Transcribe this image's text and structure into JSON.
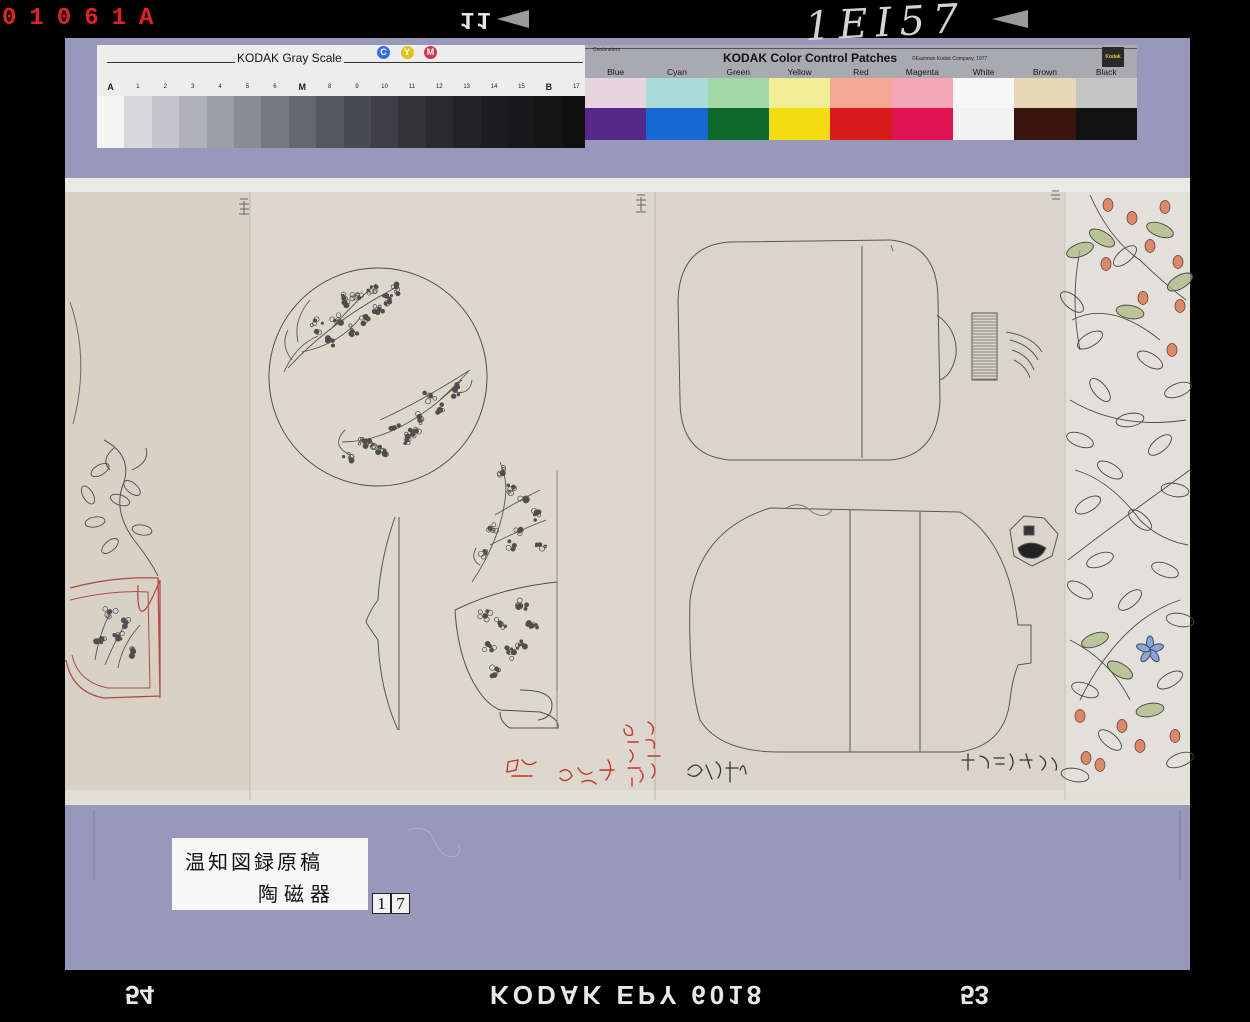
{
  "film_edge": {
    "top_left_code": "01061A",
    "frame_number": "11",
    "handwritten_label": "1EI57",
    "bottom_left_number": "54",
    "bottom_film_type": "KODAK EPY 6018",
    "bottom_right_number": "53"
  },
  "gray_scale": {
    "title": "KODAK Gray Scale",
    "cym": [
      {
        "letter": "C",
        "color": "#3a6bde"
      },
      {
        "letter": "Y",
        "color": "#e4c21c"
      },
      {
        "letter": "M",
        "color": "#d8344a"
      }
    ],
    "steps": [
      {
        "label": "A",
        "tone": "#f4f4f4"
      },
      {
        "label": "1",
        "tone": "#d8d8dc"
      },
      {
        "label": "2",
        "tone": "#c4c4ca"
      },
      {
        "label": "3",
        "tone": "#b1b1b9"
      },
      {
        "label": "4",
        "tone": "#9e9ea7"
      },
      {
        "label": "5",
        "tone": "#8b8b95"
      },
      {
        "label": "6",
        "tone": "#787883"
      },
      {
        "label": "M",
        "tone": "#676770"
      },
      {
        "label": "8",
        "tone": "#57575f"
      },
      {
        "label": "9",
        "tone": "#4a4a51"
      },
      {
        "label": "10",
        "tone": "#3e3e44"
      },
      {
        "label": "11",
        "tone": "#333338"
      },
      {
        "label": "12",
        "tone": "#2a2a2e"
      },
      {
        "label": "13",
        "tone": "#232326"
      },
      {
        "label": "14",
        "tone": "#1d1d1f"
      },
      {
        "label": "15",
        "tone": "#18181a"
      },
      {
        "label": "B",
        "tone": "#141415"
      },
      {
        "label": "17",
        "tone": "#101011"
      }
    ]
  },
  "color_patches": {
    "units_label": "Centimeters",
    "title": "KODAK Color Control Patches",
    "copyright": "©Eastman Kodak Company, 1977",
    "logo_text": "Kodak",
    "patches": [
      {
        "label": "Blue",
        "tint": "#e6d4df",
        "solid": "#56288a"
      },
      {
        "label": "Cyan",
        "tint": "#a9dcd8",
        "solid": "#1668d4"
      },
      {
        "label": "Green",
        "tint": "#a2d7a6",
        "solid": "#0e6a2c"
      },
      {
        "label": "Yellow",
        "tint": "#f1ee98",
        "solid": "#f4dc12"
      },
      {
        "label": "Red",
        "tint": "#f5a894",
        "solid": "#d81a1a"
      },
      {
        "label": "Magenta",
        "tint": "#f3a6b4",
        "solid": "#e0124f"
      },
      {
        "label": "White",
        "tint": "#f7f7f7",
        "solid": "#f2f2f2"
      },
      {
        "label": "Brown",
        "tint": "#e5d6b5",
        "solid": "#3a1510"
      },
      {
        "label": "Black",
        "tint": "#c4c4c4",
        "solid": "#121212"
      }
    ]
  },
  "catalog_label": {
    "title": "温知図録原稿",
    "category": "陶磁器",
    "plate_number": [
      "1",
      "7"
    ]
  },
  "colors": {
    "mount": "#9898ba",
    "paper_left": "#d7d2c5",
    "paper_middle": "#dcd8ce",
    "paper_right": "#d9d5cb",
    "paper_far_right": "#e3e0d9",
    "pencil": "#4e4e4e",
    "red_ink": "#c4352c",
    "berry": "#d98a6a",
    "leaf_tint": "#a8b77f"
  }
}
